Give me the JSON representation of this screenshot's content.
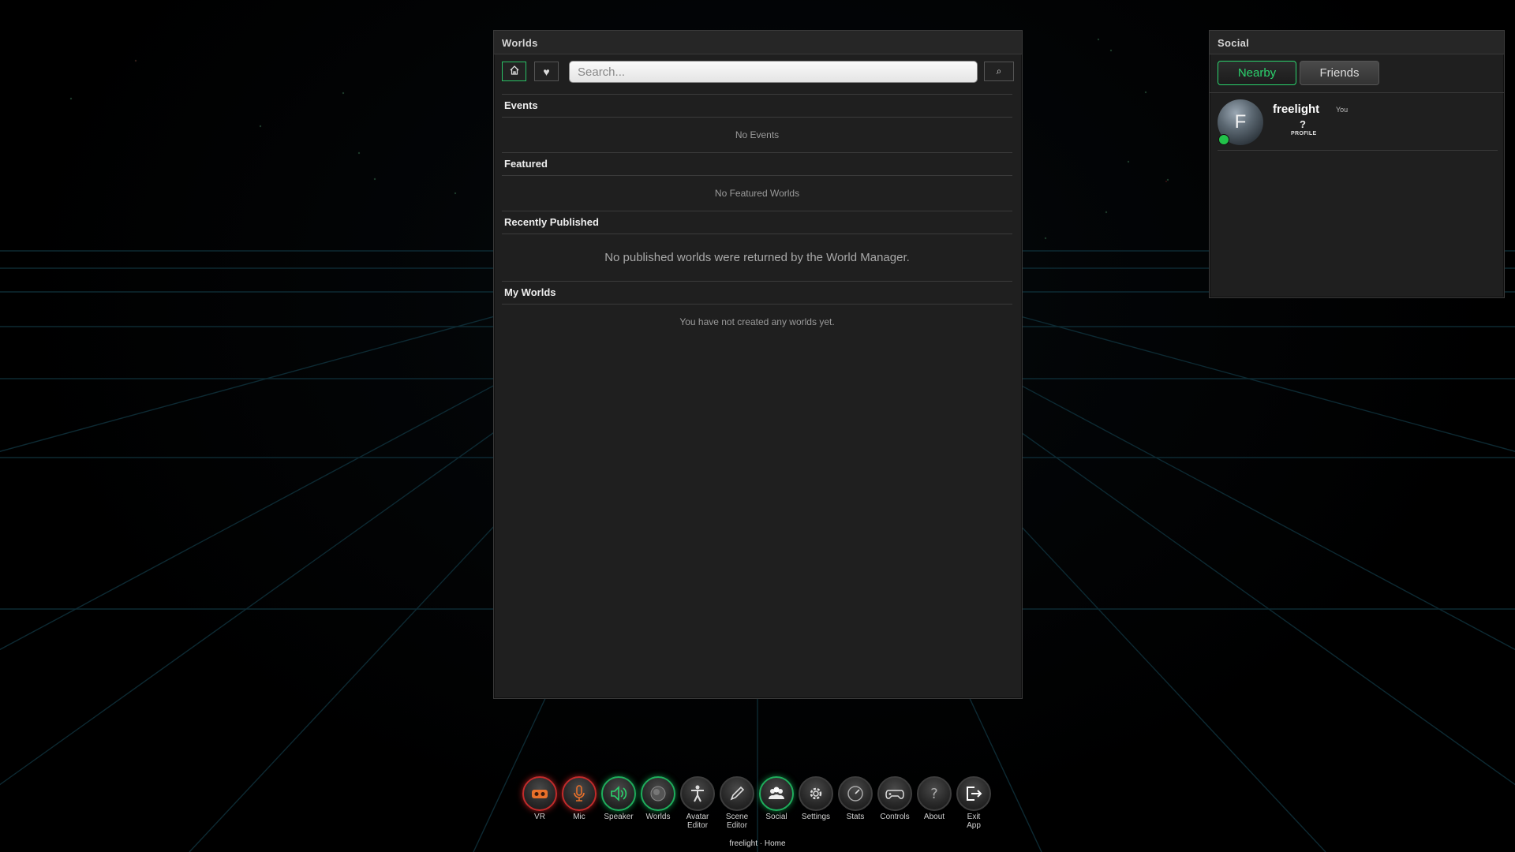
{
  "worlds_panel": {
    "title": "Worlds",
    "search_placeholder": "Search...",
    "home_icon": "home-icon",
    "favorite_icon": "heart-icon",
    "search_icon": "search-icon",
    "sections": [
      {
        "title": "Events",
        "empty_text": "No Events"
      },
      {
        "title": "Featured",
        "empty_text": "No Featured Worlds"
      },
      {
        "title": "Recently Published",
        "empty_text": "No published worlds were returned by the World Manager."
      },
      {
        "title": "My Worlds",
        "empty_text": "You have not created any worlds yet."
      }
    ]
  },
  "social_panel": {
    "title": "Social",
    "tabs": [
      {
        "label": "Nearby",
        "active": true
      },
      {
        "label": "Friends",
        "active": false
      }
    ],
    "user": {
      "avatar_initial": "F",
      "name": "freelight",
      "you_label": "You",
      "profile_symbol": "?",
      "profile_label": "PROFILE",
      "status": "online"
    }
  },
  "dock": {
    "items": [
      {
        "label": "VR",
        "icon": "vr-headset-icon",
        "state": "red"
      },
      {
        "label": "Mic",
        "icon": "microphone-icon",
        "state": "red"
      },
      {
        "label": "Speaker",
        "icon": "speaker-icon",
        "state": "green"
      },
      {
        "label": "Worlds",
        "icon": "globe-icon",
        "state": "green"
      },
      {
        "label": "Avatar Editor",
        "icon": "avatar-icon",
        "state": "normal"
      },
      {
        "label": "Scene Editor",
        "icon": "pencil-icon",
        "state": "normal"
      },
      {
        "label": "Social",
        "icon": "people-icon",
        "state": "green"
      },
      {
        "label": "Settings",
        "icon": "gear-icon",
        "state": "normal"
      },
      {
        "label": "Stats",
        "icon": "gauge-icon",
        "state": "normal"
      },
      {
        "label": "Controls",
        "icon": "gamepad-icon",
        "state": "normal"
      },
      {
        "label": "About",
        "icon": "question-icon",
        "state": "normal"
      },
      {
        "label": "Exit App",
        "icon": "exit-icon",
        "state": "normal"
      }
    ]
  },
  "status_bar": {
    "text": "freelight · Home"
  },
  "colors": {
    "accent_green": "#2bd36d",
    "alert_red": "#c22b2b",
    "panel_bg": "#1f1f1f"
  }
}
